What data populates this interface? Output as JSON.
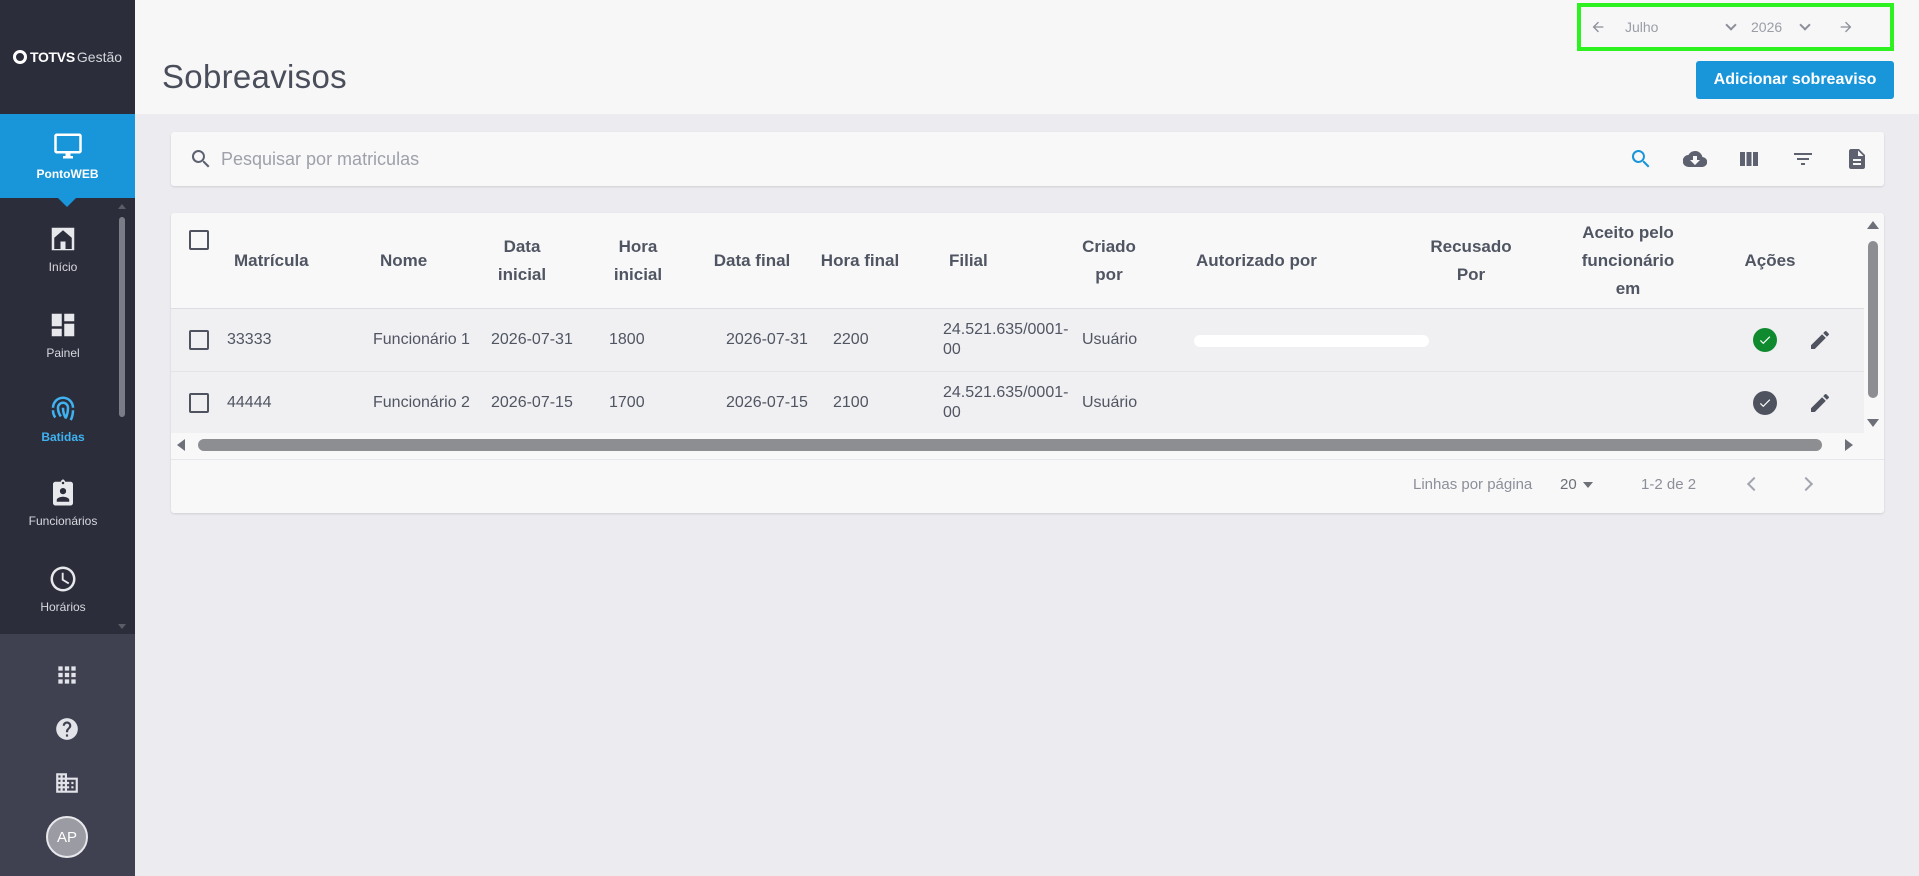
{
  "app": {
    "logo_brand": "TOTVS",
    "logo_product": "Gestão"
  },
  "sidebar": {
    "active": {
      "label": "PontoWEB",
      "icon": "monitor-icon"
    },
    "items": [
      {
        "label": "Início",
        "icon": "home-icon"
      },
      {
        "label": "Painel",
        "icon": "dashboard-icon"
      },
      {
        "label": "Batidas",
        "icon": "fingerprint-icon"
      },
      {
        "label": "Funcionários",
        "icon": "badge-icon"
      },
      {
        "label": "Horários",
        "icon": "clock-icon"
      }
    ],
    "bottom": [
      {
        "icon": "apps-grid-icon"
      },
      {
        "icon": "help-icon"
      },
      {
        "icon": "building-icon"
      }
    ],
    "avatar_initials": "AP",
    "colors": {
      "background": "#2c2d3a",
      "active": "#1996d9",
      "accent": "#3fb3f2"
    }
  },
  "header": {
    "title": "Sobreavisos",
    "period": {
      "month": "Julho",
      "year": "2026"
    },
    "add_button_label": "Adicionar sobreaviso"
  },
  "search": {
    "placeholder": "Pesquisar por matriculas",
    "value": "",
    "tools": [
      "search-icon",
      "cloud-download-icon",
      "columns-icon",
      "filter-icon",
      "document-icon"
    ]
  },
  "table": {
    "columns": [
      "Matrícula",
      "Nome",
      "Data inicial",
      "Hora inicial",
      "Data final",
      "Hora final",
      "Filial",
      "Criado por",
      "Autorizado por",
      "Recusado Por",
      "Aceito pelo funcionário em",
      "Ações"
    ],
    "rows": [
      {
        "matricula": "33333",
        "nome": "Funcionário 1",
        "data_inicial": "2026-07-31",
        "hora_inicial": "1800",
        "data_final": "2026-07-31",
        "hora_final": "2200",
        "filial": "24.521.635/0001-00",
        "criado_por": "Usuário",
        "autorizado_por": "",
        "recusado_por": "",
        "aceito_em": "",
        "status": "approved"
      },
      {
        "matricula": "44444",
        "nome": "Funcionário 2",
        "data_inicial": "2026-07-15",
        "hora_inicial": "1700",
        "data_final": "2026-07-15",
        "hora_final": "2100",
        "filial": "24.521.635/0001-00",
        "criado_por": "Usuário",
        "autorizado_por": "",
        "recusado_por": "",
        "aceito_em": "",
        "status": "pending"
      }
    ],
    "status_colors": {
      "approved": "#0f8a2e",
      "pending": "#4f5360"
    }
  },
  "pagination": {
    "rows_per_page_label": "Linhas por página",
    "rows_per_page": "20",
    "range": "1-2 de 2"
  }
}
